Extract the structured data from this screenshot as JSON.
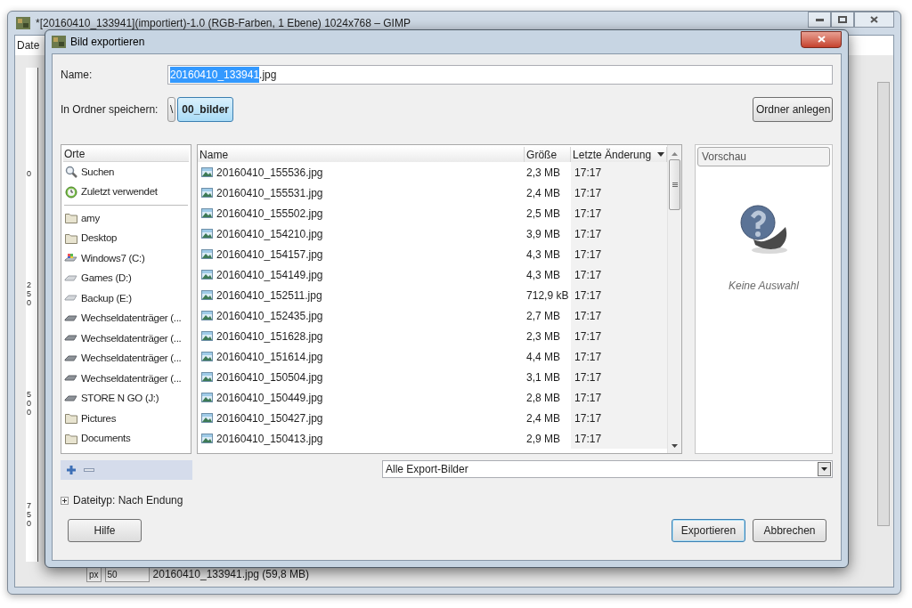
{
  "gimp_window": {
    "title": "*[20160410_133941](importiert)-1.0 (RGB-Farben, 1 Ebene) 1024x768 – GIMP",
    "menu": [
      "Date"
    ],
    "ruler_labels": [
      "0",
      "250",
      "500",
      "750"
    ],
    "status_bar": {
      "unit": "px",
      "zoom": "50",
      "file_info": "20160410_133941.jpg (59,8 MB)"
    }
  },
  "dialog": {
    "title": "Bild exportieren",
    "name_field": {
      "label": "Name:",
      "selected_text": "20160410_133941",
      "rest_text": ".jpg"
    },
    "folder": {
      "label": "In Ordner speichern:",
      "path": [
        {
          "label": "\\",
          "selected": false
        },
        {
          "label": "00_bilder",
          "selected": true
        }
      ],
      "create_button": "Ordner anlegen"
    },
    "places": {
      "header": "Orte",
      "items": [
        {
          "kind": "search",
          "label": "Suchen"
        },
        {
          "kind": "recent",
          "label": "Zuletzt verwendet"
        },
        {
          "kind": "separator"
        },
        {
          "kind": "folder",
          "label": "amy"
        },
        {
          "kind": "folder",
          "label": "Desktop"
        },
        {
          "kind": "system_drive",
          "label": "Windows7 (C:)"
        },
        {
          "kind": "drive",
          "label": "Games (D:)"
        },
        {
          "kind": "drive",
          "label": "Backup (E:)"
        },
        {
          "kind": "removable",
          "label": "Wechseldatenträger (..."
        },
        {
          "kind": "removable",
          "label": "Wechseldatenträger (..."
        },
        {
          "kind": "removable",
          "label": "Wechseldatenträger (..."
        },
        {
          "kind": "removable",
          "label": "Wechseldatenträger (..."
        },
        {
          "kind": "removable",
          "label": "STORE N GO (J:)"
        },
        {
          "kind": "folder",
          "label": "Pictures"
        },
        {
          "kind": "folder",
          "label": "Documents"
        }
      ]
    },
    "files": {
      "columns": [
        {
          "label": "Name",
          "sorted": false
        },
        {
          "label": "Größe",
          "sorted": false
        },
        {
          "label": "Letzte Änderung",
          "sorted": true
        }
      ],
      "rows": [
        {
          "name": "20160410_155536.jpg",
          "size": "2,3 MB",
          "modified": "17:17"
        },
        {
          "name": "20160410_155531.jpg",
          "size": "2,4 MB",
          "modified": "17:17"
        },
        {
          "name": "20160410_155502.jpg",
          "size": "2,5 MB",
          "modified": "17:17"
        },
        {
          "name": "20160410_154210.jpg",
          "size": "3,9 MB",
          "modified": "17:17"
        },
        {
          "name": "20160410_154157.jpg",
          "size": "4,3 MB",
          "modified": "17:17"
        },
        {
          "name": "20160410_154149.jpg",
          "size": "4,3 MB",
          "modified": "17:17"
        },
        {
          "name": "20160410_152511.jpg",
          "size": "712,9 kB",
          "modified": "17:17"
        },
        {
          "name": "20160410_152435.jpg",
          "size": "2,7 MB",
          "modified": "17:17"
        },
        {
          "name": "20160410_151628.jpg",
          "size": "2,3 MB",
          "modified": "17:17"
        },
        {
          "name": "20160410_151614.jpg",
          "size": "4,4 MB",
          "modified": "17:17"
        },
        {
          "name": "20160410_150504.jpg",
          "size": "3,1 MB",
          "modified": "17:17"
        },
        {
          "name": "20160410_150449.jpg",
          "size": "2,8 MB",
          "modified": "17:17"
        },
        {
          "name": "20160410_150427.jpg",
          "size": "2,4 MB",
          "modified": "17:17"
        },
        {
          "name": "20160410_150413.jpg",
          "size": "2,9 MB",
          "modified": "17:17"
        }
      ]
    },
    "preview": {
      "header": "Vorschau",
      "message": "Keine Auswahl"
    },
    "filter": {
      "value": "Alle Export-Bilder"
    },
    "file_type": {
      "label": "Dateityp: Nach Endung",
      "expanded": false
    },
    "buttons": [
      {
        "label": "Hilfe",
        "default": false
      },
      {
        "label": "Exportieren",
        "default": true
      },
      {
        "label": "Abbrechen",
        "default": false
      }
    ]
  }
}
